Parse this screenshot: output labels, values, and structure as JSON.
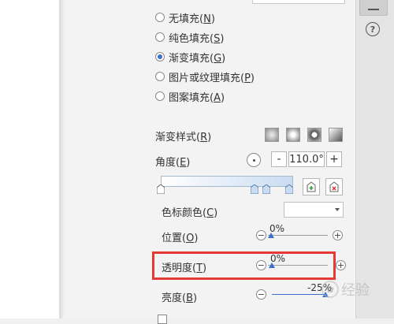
{
  "fill_options": [
    {
      "label": "无填充(",
      "key": "N",
      "checked": false
    },
    {
      "label": "纯色填充(",
      "key": "S",
      "checked": false
    },
    {
      "label": "渐变填充(",
      "key": "G",
      "checked": true
    },
    {
      "label": "图片或纹理填充(",
      "key": "P",
      "checked": false
    },
    {
      "label": "图案填充(",
      "key": "A",
      "checked": false
    }
  ],
  "gradient": {
    "style_label": "渐变样式(",
    "style_key": "R",
    "angle_label": "角度(",
    "angle_key": "E",
    "angle_value": "110.0°",
    "minus": "-",
    "plus": "+"
  },
  "stop_props": {
    "color_label": "色标颜色(",
    "color_key": "C",
    "position_label": "位置(",
    "position_key": "O",
    "position_value": "0%",
    "transparency_label": "透明度(",
    "transparency_key": "T",
    "transparency_value": "0%",
    "brightness_label": "亮度(",
    "brightness_key": "B",
    "brightness_value": "-25%"
  },
  "watermark": {
    "text": "经验"
  },
  "help_icon": "?",
  "colors": {
    "accent": "#3b6fcf",
    "highlight": "#e53935"
  }
}
